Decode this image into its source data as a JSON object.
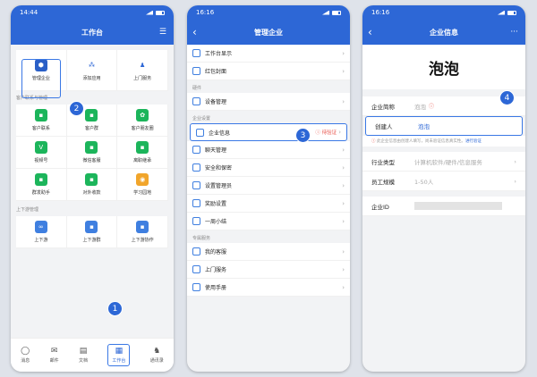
{
  "phone1": {
    "time": "14:44",
    "title": "工作台",
    "top_items": [
      "管理企业",
      "添加应用",
      "上门服务"
    ],
    "section1": "客户联系与管理",
    "grid1": [
      "客户联系",
      "客户群",
      "客户朋友圈",
      "视频号",
      "微信客服",
      "离职继承",
      "群发助手",
      "对外收款",
      "学习园地"
    ],
    "section2": "上下游管理",
    "grid2": [
      "上下游",
      "上下游群",
      "上下游协作"
    ],
    "tabs": [
      "消息",
      "邮件",
      "文档",
      "工作台",
      "通讯录"
    ]
  },
  "phone2": {
    "time": "16:16",
    "title": "管理企业",
    "rows_a": [
      "工作台显示",
      "红包封面"
    ],
    "sect_hw": "硬件",
    "rows_b": [
      "设备管理"
    ],
    "sect_sec": "企业设置",
    "company_info": "企业信息",
    "pending": "待验证",
    "rows_c": [
      "聊天管理",
      "安全和保密",
      "设置管理员",
      "奖励设置",
      "一周小结"
    ],
    "sect_svc": "专属服务",
    "rows_d": [
      "我的客服",
      "上门服务",
      "使用手册"
    ]
  },
  "phone3": {
    "time": "16:16",
    "title": "企业信息",
    "more": "···",
    "company_name": "泡泡",
    "short_label": "企业简称",
    "short_value": "泡泡",
    "creator_label": "创建人",
    "creator_value": "泡泡",
    "warning": "此企业信息由创建人填写，尚未验证信息真实性。",
    "verify_link": "进行验证",
    "industry_label": "行业类型",
    "industry_value": "计算机软件/硬件/信息服务",
    "staff_label": "员工规模",
    "staff_value": "1-50人",
    "id_label": "企业ID"
  },
  "badges": [
    "1",
    "2",
    "3",
    "4"
  ],
  "colors": {
    "brand": "#2d67d6",
    "highlight": "#3a78e5",
    "green": "#1cb55b",
    "orange": "#f1a52b",
    "pending": "#e8534a"
  }
}
